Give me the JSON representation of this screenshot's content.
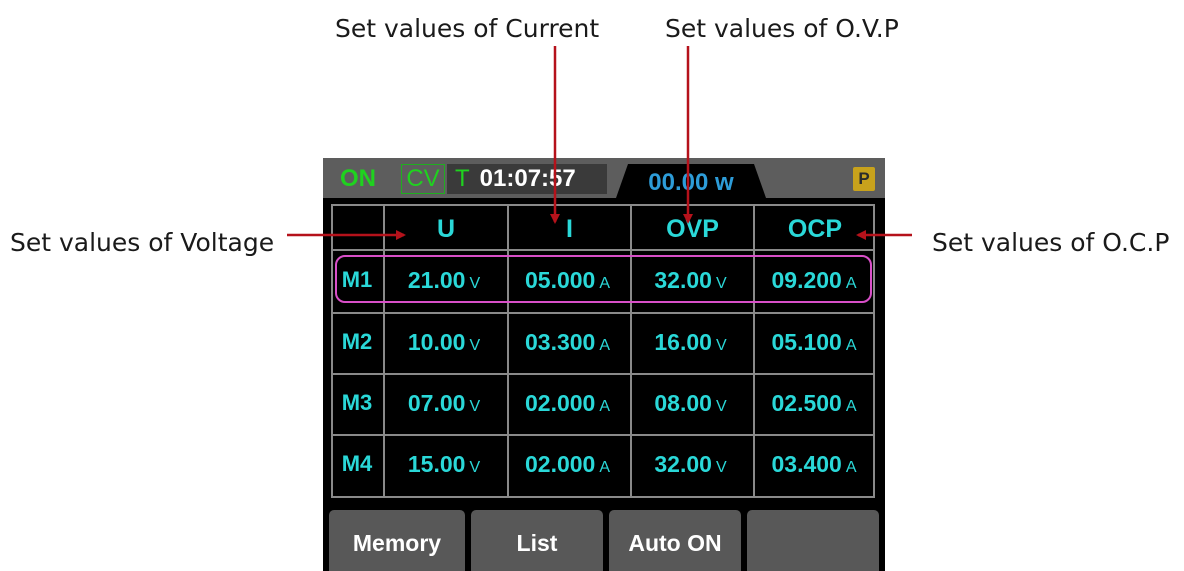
{
  "callouts": {
    "current": "Set values of Current",
    "ovp": "Set values of O.V.P",
    "voltage": "Set values of Voltage",
    "ocp": "Set values of O.C.P"
  },
  "colors": {
    "arrow": "#b5121b",
    "value_text": "#2ad8d8",
    "status_green": "#1fd21f",
    "power_blue": "#2d9cd8",
    "highlight": "#d94fc8",
    "badge": "#c8a21c"
  },
  "status_bar": {
    "output": "ON",
    "mode": "CV",
    "timer_letter": "T",
    "timer": "01:07:57",
    "power": "00.00 w",
    "badge": "P"
  },
  "table": {
    "headers": [
      "U",
      "I",
      "OVP",
      "OCP"
    ],
    "selected_row": "M1",
    "rows": [
      {
        "label": "M1",
        "u": "21.00",
        "u_unit": "V",
        "i": "05.000",
        "i_unit": "A",
        "ovp": "32.00",
        "ovp_unit": "V",
        "ocp": "09.200",
        "ocp_unit": "A"
      },
      {
        "label": "M2",
        "u": "10.00",
        "u_unit": "V",
        "i": "03.300",
        "i_unit": "A",
        "ovp": "16.00",
        "ovp_unit": "V",
        "ocp": "05.100",
        "ocp_unit": "A"
      },
      {
        "label": "M3",
        "u": "07.00",
        "u_unit": "V",
        "i": "02.000",
        "i_unit": "A",
        "ovp": "08.00",
        "ovp_unit": "V",
        "ocp": "02.500",
        "ocp_unit": "A"
      },
      {
        "label": "M4",
        "u": "15.00",
        "u_unit": "V",
        "i": "02.000",
        "i_unit": "A",
        "ovp": "32.00",
        "ovp_unit": "V",
        "ocp": "03.400",
        "ocp_unit": "A"
      }
    ]
  },
  "softkeys": [
    "Memory",
    "List",
    "Auto ON",
    ""
  ]
}
